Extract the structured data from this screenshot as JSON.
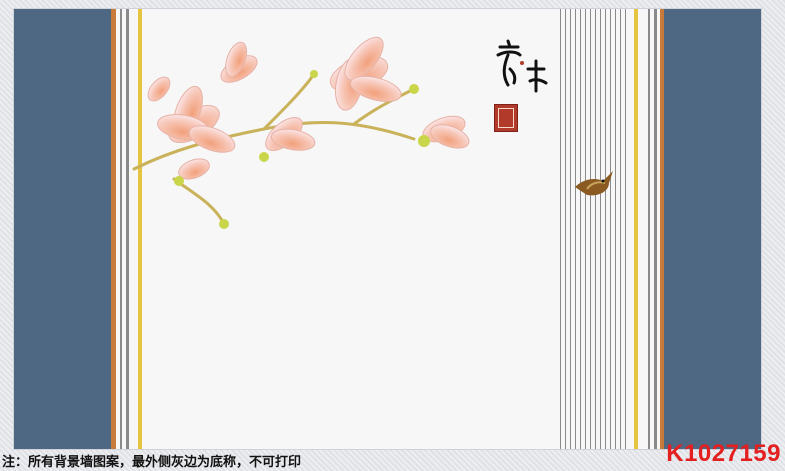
{
  "caption": "注：所有背景墙图案，最外侧灰边为底称，不可打印",
  "code": "K1027159",
  "colors": {
    "side_panel": "#4e6884",
    "background": "#f7f7f7",
    "stripe_orange": "#c77a3a",
    "stripe_gold": "#e4c441",
    "stripe_gray": "#8a8a8a"
  },
  "decorations": [
    "magnolia-flowers",
    "calligraphy",
    "red-seal",
    "bird"
  ]
}
